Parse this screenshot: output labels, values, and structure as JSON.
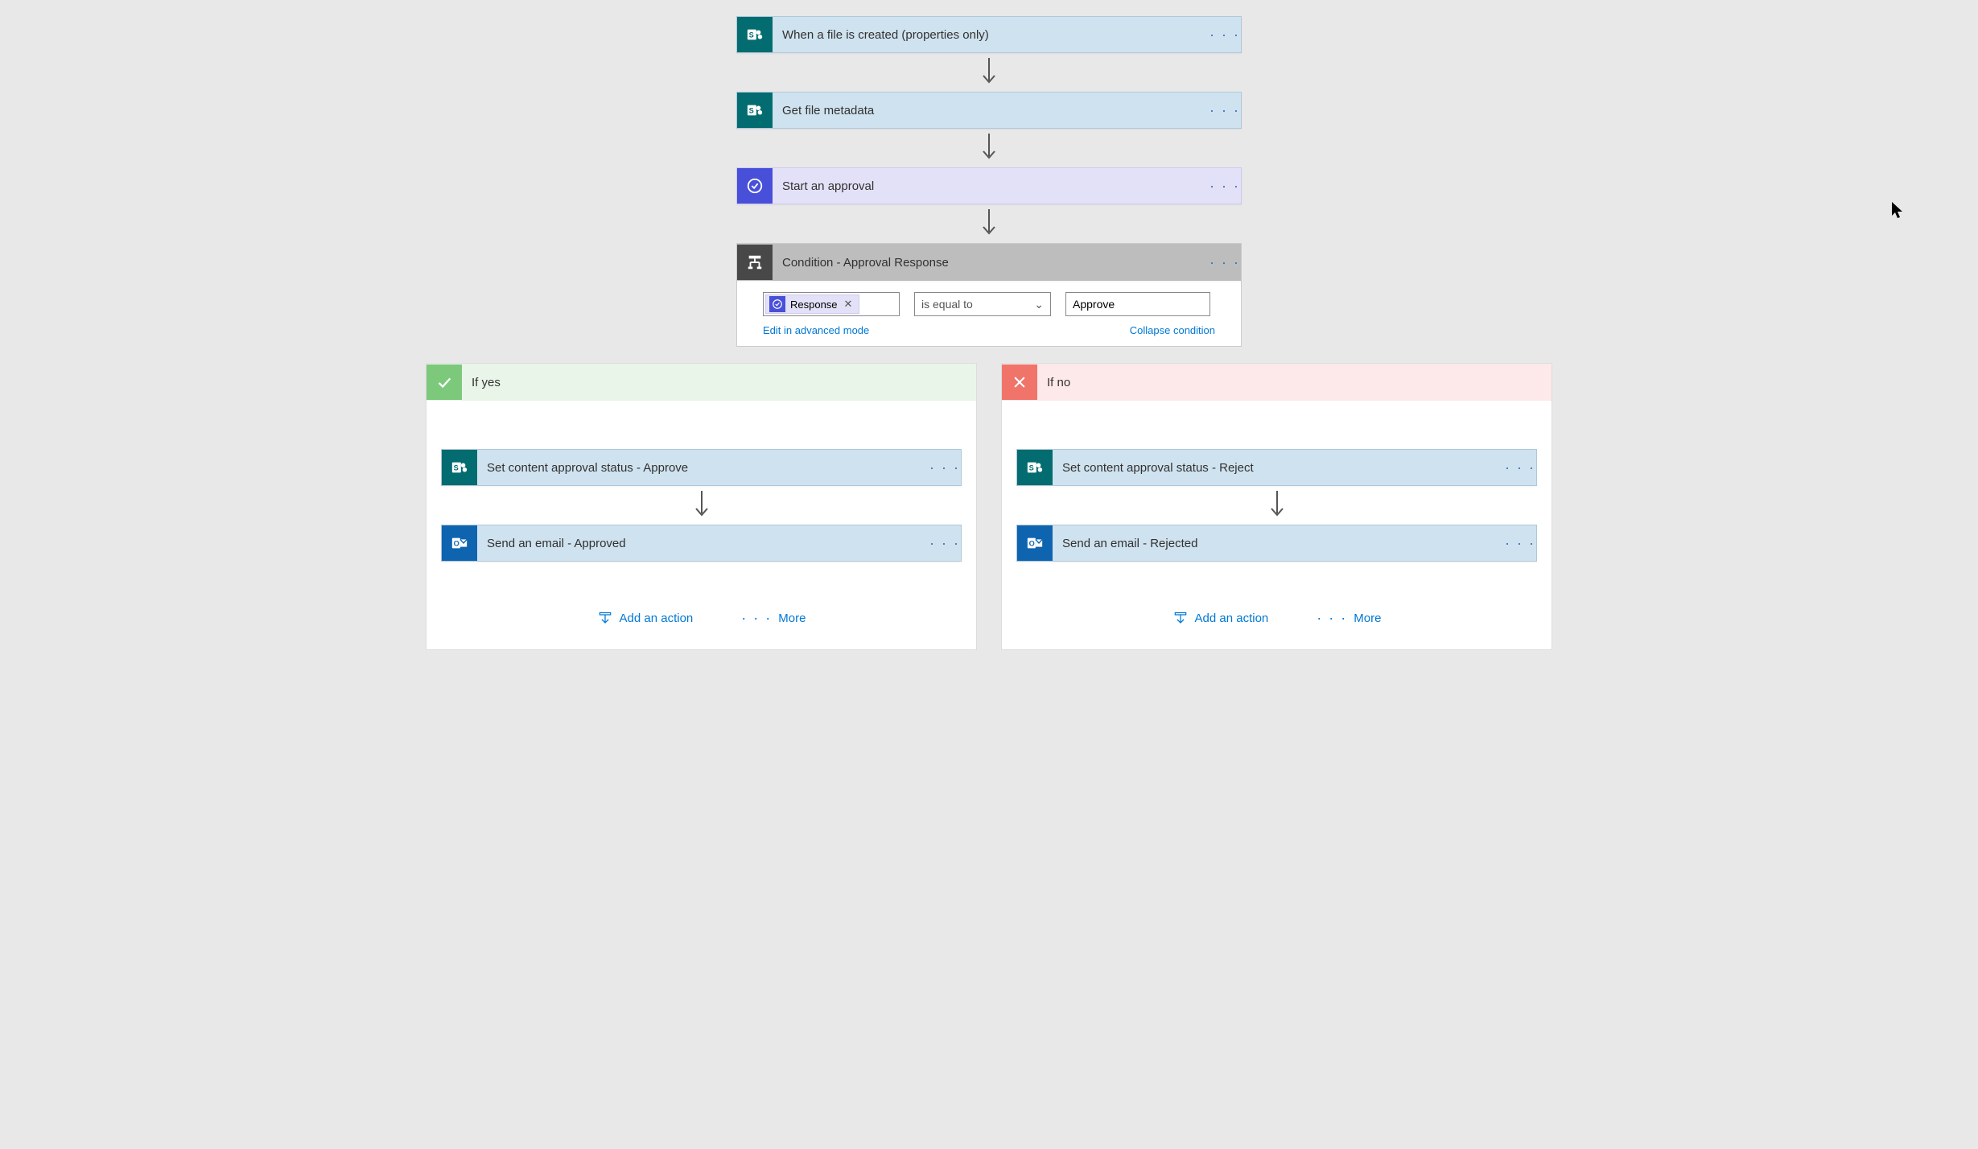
{
  "steps": {
    "trigger": {
      "label": "When a file is created (properties only)"
    },
    "metadata": {
      "label": "Get file metadata"
    },
    "approval": {
      "label": "Start an approval"
    },
    "condition": {
      "label": "Condition - Approval Response"
    }
  },
  "condition": {
    "token_label": "Response",
    "operator": "is equal to",
    "value": "Approve",
    "edit_link": "Edit in advanced mode",
    "collapse_link": "Collapse condition"
  },
  "branches": {
    "yes": {
      "title": "If yes",
      "step1": "Set content approval status - Approve",
      "step2": "Send an email - Approved"
    },
    "no": {
      "title": "If no",
      "step1": "Set content approval status - Reject",
      "step2": "Send an email - Rejected"
    },
    "add_action": "Add an action",
    "more": "More"
  }
}
